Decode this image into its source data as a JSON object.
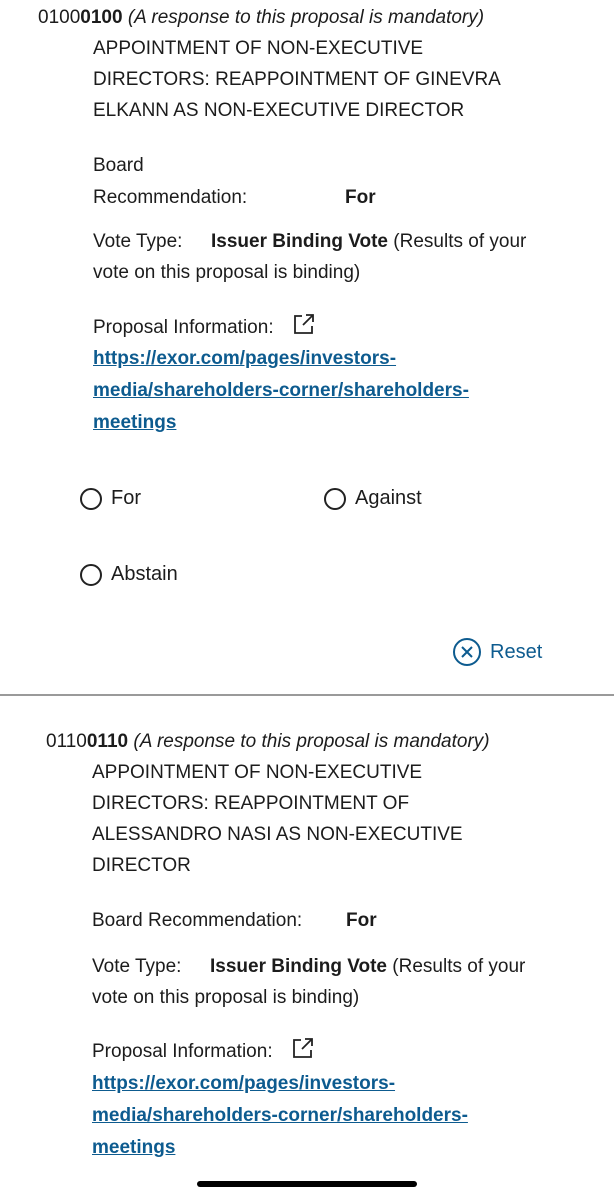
{
  "proposals": [
    {
      "id_prefix": "0100",
      "id_suffix": "0100",
      "mandatory_note": "(A response to this proposal is mandatory)",
      "title_lines": [
        "APPOINTMENT OF NON-EXECUTIVE",
        "DIRECTORS: REAPPOINTMENT OF GINEVRA",
        "ELKANN AS NON-EXECUTIVE DIRECTOR"
      ],
      "board_rec_label_line1": "Board",
      "board_rec_label_line2": "Recommendation:",
      "board_rec_value": "For",
      "vote_type_label": "Vote Type:",
      "vote_type_value": "Issuer Binding Vote",
      "vote_type_note_part1": "(Results of your",
      "vote_type_note_part2": "vote on this proposal is binding)",
      "proposal_info_label": "Proposal Information:",
      "link_lines": [
        "https://exor.com/pages/investors-",
        "media/shareholders-corner/shareholders-",
        "meetings"
      ],
      "options": {
        "for": "For",
        "against": "Against",
        "abstain": "Abstain"
      },
      "reset_label": "Reset"
    },
    {
      "id_prefix": "0110",
      "id_suffix": "0110",
      "mandatory_note": "(A response to this proposal is mandatory)",
      "title_lines": [
        "APPOINTMENT OF NON-EXECUTIVE",
        "DIRECTORS: REAPPOINTMENT OF",
        "ALESSANDRO NASI AS NON-EXECUTIVE",
        "DIRECTOR"
      ],
      "board_rec_label": "Board Recommendation:",
      "board_rec_value": "For",
      "vote_type_label": "Vote Type:",
      "vote_type_value": "Issuer Binding Vote",
      "vote_type_note_part1": "(Results of your",
      "vote_type_note_part2": "vote on this proposal is binding)",
      "proposal_info_label": "Proposal Information:",
      "link_lines": [
        "https://exor.com/pages/investors-",
        "media/shareholders-corner/shareholders-",
        "meetings"
      ]
    }
  ],
  "icons": {
    "external_link": "external-link-icon",
    "reset": "close-circle-icon",
    "radio": "radio-circle"
  },
  "colors": {
    "link": "#0d5b8f",
    "divider": "#9a9a9a",
    "text": "#1c1c1c"
  }
}
